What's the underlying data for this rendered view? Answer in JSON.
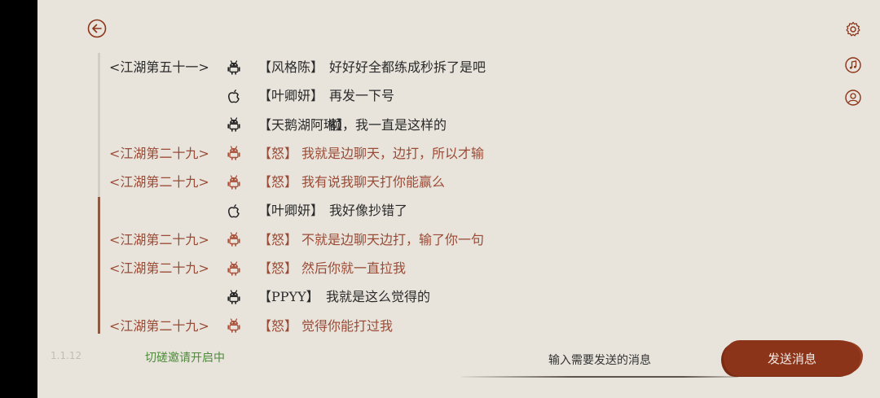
{
  "app": {
    "version": "1.1.12",
    "invite_status": "切磋邀请开启中",
    "accent_color": "#8c3419",
    "angry_text_color": "#9a4b36"
  },
  "icons": {
    "back": "back-arrow-icon",
    "settings": "gear-icon",
    "music": "music-note-icon",
    "profile": "user-icon",
    "android": "android-icon",
    "apple": "apple-icon"
  },
  "messages": [
    {
      "server": "<江湖第五十一>",
      "platform": "android",
      "name": "【风格陈】",
      "text": "好好好全都练成秒拆了是吧",
      "style": "normal"
    },
    {
      "server": "",
      "platform": "apple",
      "name": "【叶卿妍】",
      "text": "再发一下号",
      "style": "normal"
    },
    {
      "server": "",
      "platform": "android",
      "name": "【天鹅湖阿琳】",
      "text": "额，我一直是这样的",
      "style": "normal"
    },
    {
      "server": "<江湖第二十九>",
      "platform": "android",
      "name": "【怒】",
      "text": "我就是边聊天，边打，所以才输",
      "style": "angry"
    },
    {
      "server": "<江湖第二十九>",
      "platform": "android",
      "name": "【怒】",
      "text": "我有说我聊天打你能赢么",
      "style": "angry"
    },
    {
      "server": "",
      "platform": "apple",
      "name": "【叶卿妍】",
      "text": "我好像抄错了",
      "style": "normal"
    },
    {
      "server": "<江湖第二十九>",
      "platform": "android",
      "name": "【怒】",
      "text": "不就是边聊天边打，输了你一句",
      "style": "angry"
    },
    {
      "server": "<江湖第二十九>",
      "platform": "android",
      "name": "【怒】",
      "text": "然后你就一直拉我",
      "style": "angry"
    },
    {
      "server": "",
      "platform": "android",
      "name": "【PPYY】",
      "text": "我就是这么觉得的",
      "style": "short"
    },
    {
      "server": "<江湖第二十九>",
      "platform": "android",
      "name": "【怒】",
      "text": "觉得你能打过我",
      "style": "angry"
    }
  ],
  "chat_input": {
    "value": "",
    "placeholder": "输入需要发送的消息"
  },
  "send_button": {
    "label": "发送消息"
  }
}
